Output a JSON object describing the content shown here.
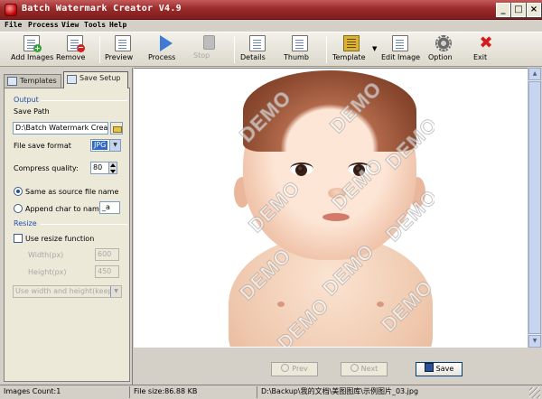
{
  "window": {
    "title": "Batch Watermark Creator V4.9"
  },
  "menu": [
    "File",
    "Process",
    "View",
    "Tools",
    "Help"
  ],
  "toolbar": {
    "add_images": "Add Images",
    "remove": "Remove",
    "preview": "Preview",
    "process": "Process",
    "stop": "Stop",
    "details": "Details",
    "thumb": "Thumb",
    "template": "Template",
    "edit_image": "Edit Image",
    "option": "Option",
    "exit": "Exit"
  },
  "tabs": {
    "templates": "Templates",
    "save_setup": "Save Setup"
  },
  "output": {
    "group_title": "Output",
    "save_path_label": "Save Path",
    "save_path_value": "D:\\Batch Watermark Creator\\C",
    "file_format_label": "File save format",
    "file_format_value": "JPG",
    "compress_label": "Compress quality:",
    "compress_value": "80",
    "same_name_label": "Same as source file name",
    "append_label": "Append char to name:",
    "append_value": "_a"
  },
  "resize": {
    "group_title": "Resize",
    "use_resize_label": "Use resize function",
    "width_label": "Width(px)",
    "width_value": "600",
    "height_label": "Height(px)",
    "height_value": "450",
    "mode_value": "Use width and height(keep asp"
  },
  "preview": {
    "watermark_text": "DEMO"
  },
  "nav": {
    "prev": "Prev",
    "next": "Next",
    "save": "Save"
  },
  "status": {
    "images_count": "Images Count:1",
    "file_size": "File size:86.88 KB",
    "file_path": "D:\\Backup\\我的文档\\美图图库\\示例图片_03.jpg"
  }
}
